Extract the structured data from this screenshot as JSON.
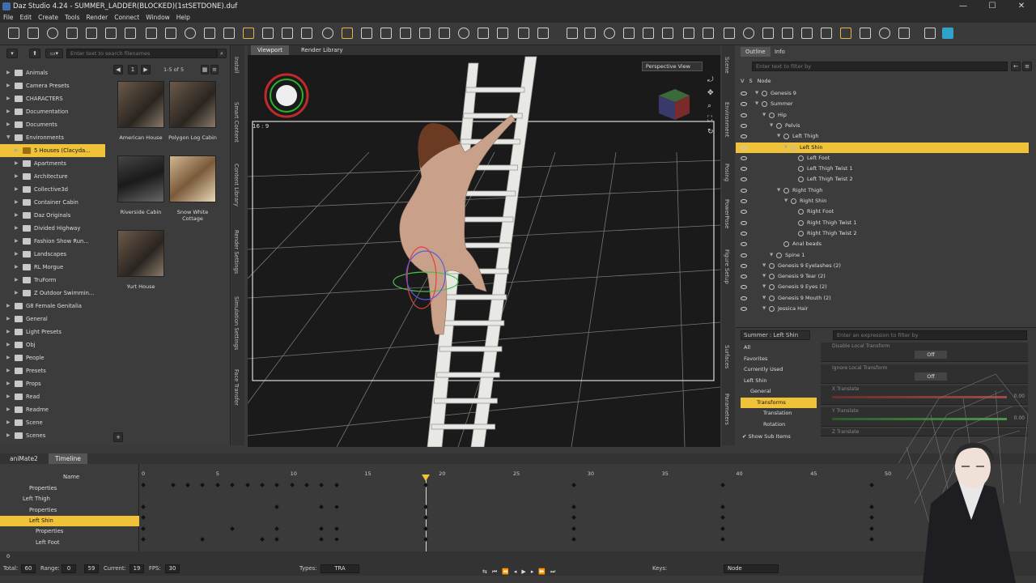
{
  "window": {
    "title": "Daz Studio 4.24 - SUMMER_LADDER(BLOCKED)(1stSETDONE).duf",
    "controls": [
      "—",
      "☐",
      "✕"
    ]
  },
  "menu": [
    "File",
    "Edit",
    "Create",
    "Tools",
    "Render",
    "Connect",
    "Window",
    "Help"
  ],
  "library": {
    "search_placeholder": "Enter text to search filenames",
    "page_label": "1-5 of 5",
    "page_number": "1",
    "tree": [
      {
        "label": "Animals",
        "depth": 0,
        "expanded": false
      },
      {
        "label": "Camera Presets",
        "depth": 0,
        "expanded": false
      },
      {
        "label": "CHARACTERS",
        "depth": 0,
        "expanded": false
      },
      {
        "label": "Documentation",
        "depth": 0,
        "expanded": false
      },
      {
        "label": "Documents",
        "depth": 0,
        "expanded": false
      },
      {
        "label": "Environments",
        "depth": 0,
        "expanded": true
      },
      {
        "label": "5 Houses (Clacyda...",
        "depth": 1,
        "expanded": false,
        "selected": true
      },
      {
        "label": "Apartments",
        "depth": 1,
        "expanded": false
      },
      {
        "label": "Architecture",
        "depth": 1,
        "expanded": false
      },
      {
        "label": "Collective3d",
        "depth": 1,
        "expanded": false
      },
      {
        "label": "Container Cabin",
        "depth": 1,
        "expanded": false
      },
      {
        "label": "Daz Originals",
        "depth": 1,
        "expanded": false
      },
      {
        "label": "Divided Highway",
        "depth": 1,
        "expanded": false
      },
      {
        "label": "Fashion Show Run...",
        "depth": 1,
        "expanded": false
      },
      {
        "label": "Landscapes",
        "depth": 1,
        "expanded": false
      },
      {
        "label": "RL Morgue",
        "depth": 1,
        "expanded": false
      },
      {
        "label": "TruForm",
        "depth": 1,
        "expanded": false
      },
      {
        "label": "Z Outdoor Swimmin...",
        "depth": 1,
        "expanded": false
      },
      {
        "label": "G8 Female Genitalia",
        "depth": 0,
        "expanded": false
      },
      {
        "label": "General",
        "depth": 0,
        "expanded": false
      },
      {
        "label": "Light Presets",
        "depth": 0,
        "expanded": false
      },
      {
        "label": "Obj",
        "depth": 0,
        "expanded": false
      },
      {
        "label": "People",
        "depth": 0,
        "expanded": false
      },
      {
        "label": "Presets",
        "depth": 0,
        "expanded": false
      },
      {
        "label": "Props",
        "depth": 0,
        "expanded": false
      },
      {
        "label": "Read",
        "depth": 0,
        "expanded": false
      },
      {
        "label": "Readme",
        "depth": 0,
        "expanded": false
      },
      {
        "label": "Scene",
        "depth": 0,
        "expanded": false
      },
      {
        "label": "Scenes",
        "depth": 0,
        "expanded": false
      }
    ],
    "tiles": [
      {
        "label": "American House",
        "style": "a"
      },
      {
        "label": "Polygon Log Cabin",
        "style": "a"
      },
      {
        "label": "Riverside Cabin",
        "style": "b"
      },
      {
        "label": "Snow White Cottage",
        "style": "c"
      },
      {
        "label": "Yurt House",
        "style": "a"
      }
    ],
    "side_tabs": [
      "Install",
      "Smart Content",
      "Content Library",
      "Render Settings",
      "Simulation Settings",
      "Face Transfer"
    ]
  },
  "viewport": {
    "tabs": [
      "Viewport",
      "Render Library"
    ],
    "view_mode": "Perspective View",
    "aspect": "16 : 9"
  },
  "scene": {
    "tabs": [
      "Outline",
      "Info"
    ],
    "filter_placeholder": "Enter text to filter by",
    "header": [
      "V",
      "S",
      "Node"
    ],
    "side_tabs": [
      "Scene",
      "Environment",
      "Posing",
      "PowerPose",
      "Figure Setup"
    ],
    "nodes": [
      {
        "label": "Genesis 9",
        "depth": 0,
        "icon": "figure"
      },
      {
        "label": "Summer",
        "depth": 0,
        "icon": "figure"
      },
      {
        "label": "Hip",
        "depth": 1,
        "icon": "bone"
      },
      {
        "label": "Pelvis",
        "depth": 2,
        "icon": "bone"
      },
      {
        "label": "Left Thigh",
        "depth": 3,
        "icon": "bone"
      },
      {
        "label": "Left Shin",
        "depth": 4,
        "icon": "bone",
        "selected": true
      },
      {
        "label": "Left Foot",
        "depth": 5,
        "icon": "bone"
      },
      {
        "label": "Left Thigh Twist 1",
        "depth": 5,
        "icon": "bone"
      },
      {
        "label": "Left Thigh Twist 2",
        "depth": 5,
        "icon": "bone"
      },
      {
        "label": "Right Thigh",
        "depth": 3,
        "icon": "bone"
      },
      {
        "label": "Right Shin",
        "depth": 4,
        "icon": "bone"
      },
      {
        "label": "Right Foot",
        "depth": 5,
        "icon": "bone"
      },
      {
        "label": "Right Thigh Twist 1",
        "depth": 5,
        "icon": "bone"
      },
      {
        "label": "Right Thigh Twist 2",
        "depth": 5,
        "icon": "bone"
      },
      {
        "label": "Anal beads",
        "depth": 3,
        "icon": "prop"
      },
      {
        "label": "Spine 1",
        "depth": 2,
        "icon": "bone"
      },
      {
        "label": "Genesis 9 Eyelashes (2)",
        "depth": 1,
        "icon": "figure"
      },
      {
        "label": "Genesis 9 Tear (2)",
        "depth": 1,
        "icon": "figure"
      },
      {
        "label": "Genesis 9 Eyes (2)",
        "depth": 1,
        "icon": "figure"
      },
      {
        "label": "Genesis 9 Mouth (2)",
        "depth": 1,
        "icon": "figure"
      },
      {
        "label": "Jessica Hair",
        "depth": 1,
        "icon": "figure"
      }
    ]
  },
  "parameters": {
    "node_select": "Summer : Left Shin",
    "filter_placeholder": "Enter an expression to filter by",
    "side_tabs": [
      "Surfaces",
      "Parameters"
    ],
    "groups": [
      "All",
      "Favorites",
      "Currently Used",
      "Left Shin",
      "General",
      "Transforms",
      "Translation",
      "Rotation"
    ],
    "selected_group": "Transforms",
    "show_sub_items": "Show Sub Items",
    "props": [
      {
        "name": "Disable Local Transform",
        "value": "Off",
        "kind": "toggle"
      },
      {
        "name": "Ignore Local Transform",
        "value": "Off",
        "kind": "toggle"
      },
      {
        "name": "X Translate",
        "value": "0.00",
        "kind": "slider",
        "color": "#a04a4a"
      },
      {
        "name": "Y Translate",
        "value": "0.00",
        "kind": "slider",
        "color": "#4a9a4a"
      },
      {
        "name": "Z Translate",
        "value": "",
        "kind": "slider",
        "color": "#4a5a9a"
      }
    ]
  },
  "timeline": {
    "tabs": [
      "aniMate2",
      "Timeline"
    ],
    "name_header": "Name",
    "rows": [
      {
        "label": "Properties",
        "depth": 2
      },
      {
        "label": "Left Thigh",
        "depth": 1
      },
      {
        "label": "Properties",
        "depth": 2
      },
      {
        "label": "Left Shin",
        "depth": 2,
        "selected": true
      },
      {
        "label": "Properties",
        "depth": 3
      },
      {
        "label": "Left Foot",
        "depth": 3
      }
    ],
    "ticks": [
      0,
      5,
      10,
      15,
      20,
      25,
      30,
      35,
      40,
      45,
      50
    ],
    "current_frame": 19,
    "key_frames": [
      [
        0,
        2,
        3,
        4,
        5,
        6,
        7,
        8,
        9,
        10,
        11,
        12,
        13,
        19,
        29,
        39,
        49
      ],
      [
        0,
        9,
        12,
        13,
        19,
        29,
        39,
        49
      ],
      [
        0,
        19,
        29,
        39,
        49
      ],
      [
        0,
        6,
        9,
        12,
        13,
        19,
        29,
        39,
        49
      ],
      [
        0,
        4,
        8,
        9,
        12,
        13,
        19,
        29,
        39,
        49
      ]
    ]
  },
  "status": {
    "total_label": "Total:",
    "total": "60",
    "range_label": "Range:",
    "range_start": "0",
    "range_end": "59",
    "current_label": "Current:",
    "current": "19",
    "fps_label": "FPS:",
    "fps": "30",
    "types_label": "Types:",
    "types": "TRA",
    "keys_label": "Keys:",
    "node_mode": "Node"
  }
}
